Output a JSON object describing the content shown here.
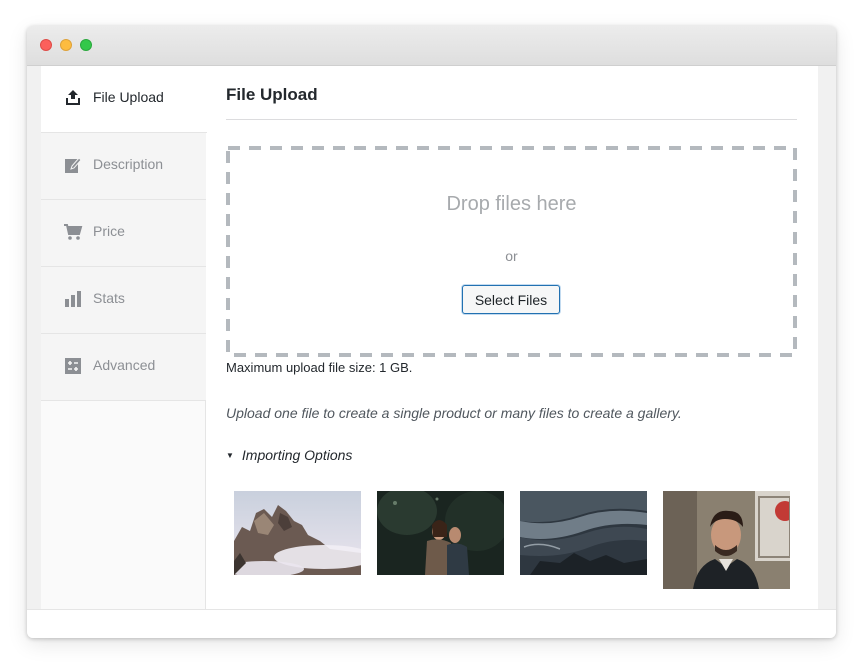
{
  "sidebar": {
    "items": [
      {
        "label": "File Upload",
        "icon": "upload-icon",
        "active": true
      },
      {
        "label": "Description",
        "icon": "edit-icon",
        "active": false
      },
      {
        "label": "Price",
        "icon": "cart-icon",
        "active": false
      },
      {
        "label": "Stats",
        "icon": "bar-chart-icon",
        "active": false
      },
      {
        "label": "Advanced",
        "icon": "advanced-settings-icon",
        "active": false
      }
    ]
  },
  "main": {
    "title": "File Upload",
    "dropzone": {
      "drop_text": "Drop files here",
      "or_text": "or",
      "select_label": "Select Files"
    },
    "max_size": "Maximum upload file size: 1 GB.",
    "hint": "Upload one file to create a single product or many files to create a gallery.",
    "importing_options": "Importing Options",
    "thumbnails": [
      {
        "subject": "mountain-peaks-in-fog"
      },
      {
        "subject": "couple-in-dark-forest"
      },
      {
        "subject": "ocean-waves-on-rocks"
      },
      {
        "subject": "portrait-of-man"
      }
    ]
  },
  "colors": {
    "accent": "#2271b1",
    "dropzone_border": "#b4b9be",
    "sidebar_bg": "#f5f5f5",
    "traffic_red": "#fc605c",
    "traffic_yellow": "#fdbc40",
    "traffic_green": "#34c84a"
  }
}
